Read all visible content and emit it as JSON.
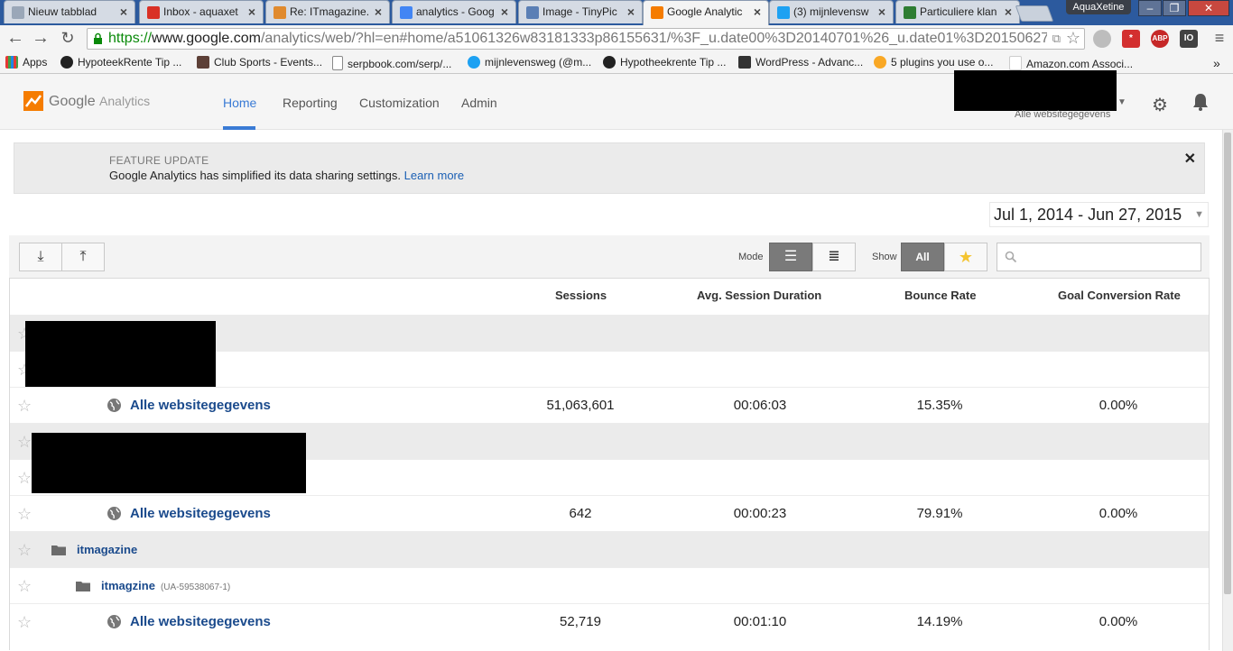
{
  "browser": {
    "tabs": [
      {
        "title": "Nieuw tabblad",
        "color": "#9aa7b8"
      },
      {
        "title": "Inbox - aquaxet",
        "color": "#d93025"
      },
      {
        "title": "Re: ITmagazine.",
        "color": "#e08a2e"
      },
      {
        "title": "analytics - Goog",
        "color": "#4285f4"
      },
      {
        "title": "Image - TinyPic",
        "color": "#5b7fb5"
      },
      {
        "title": "Google Analytic",
        "color": "#f57c00"
      },
      {
        "title": "(3) mijnlevensw",
        "color": "#1da1f2"
      },
      {
        "title": "Particuliere klan",
        "color": "#2e7d32"
      }
    ],
    "profile_name": "AquaXetine",
    "url": {
      "scheme": "https://",
      "host": "www.google.com",
      "path": "/analytics/web/?hl=en#home/a51061326w83181333p86155631/%3F_u.date00%3D20140701%26_u.date01%3D20150627/"
    },
    "extensions": [
      {
        "icon": "download-icon",
        "label": ""
      },
      {
        "icon": "lastpass-icon",
        "label": "*"
      },
      {
        "icon": "adblock-icon",
        "label": "ABP"
      },
      {
        "icon": "camera-icon",
        "label": "IO"
      }
    ],
    "bookmarks": [
      {
        "label": "Apps",
        "icon": "apps-icon"
      },
      {
        "label": "HypoteekRente Tip ...",
        "icon": "g-icon"
      },
      {
        "label": "Club Sports - Events...",
        "icon": "clubsports-icon"
      },
      {
        "label": "serpbook.com/serp/...",
        "icon": "page-icon"
      },
      {
        "label": "mijnlevensweg (@m...",
        "icon": "twitter-icon"
      },
      {
        "label": "Hypotheekrente Tip ...",
        "icon": "g-icon"
      },
      {
        "label": "WordPress - Advanc...",
        "icon": "wordpress-icon"
      },
      {
        "label": "5 plugins you use o...",
        "icon": "plugin-icon"
      },
      {
        "label": "Amazon.com Associ...",
        "icon": "amazon-icon"
      }
    ]
  },
  "ga": {
    "brand": {
      "google": "Google",
      "analytics": "Analytics"
    },
    "nav": [
      "Home",
      "Reporting",
      "Customization",
      "Admin"
    ],
    "account_label": "Alle websitegegevens",
    "banner": {
      "kicker": "FEATURE UPDATE",
      "message": "Google Analytics has simplified its data sharing settings.",
      "link": "Learn more"
    },
    "date_range": "Jul 1, 2014 - Jun 27, 2015",
    "controls": {
      "mode_label": "Mode",
      "show_label": "Show",
      "show_all": "All"
    },
    "columns": [
      "Sessions",
      "Avg. Session Duration",
      "Bounce Rate",
      "Goal Conversion Rate"
    ],
    "rows": [
      {
        "kind": "account",
        "name": "",
        "redacted": true
      },
      {
        "kind": "property",
        "name": "",
        "redacted": true
      },
      {
        "kind": "view",
        "name": "Alle websitegegevens",
        "sessions": "51,063,601",
        "duration": "00:06:03",
        "bounce": "15.35%",
        "goal": "0.00%"
      },
      {
        "kind": "account",
        "name": "",
        "redacted": true
      },
      {
        "kind": "property",
        "name": "",
        "redacted": true
      },
      {
        "kind": "view",
        "name": "Alle websitegegevens",
        "sessions": "642",
        "duration": "00:00:23",
        "bounce": "79.91%",
        "goal": "0.00%"
      },
      {
        "kind": "account",
        "name": "itmagazine"
      },
      {
        "kind": "property",
        "name": "itmagzine",
        "ua": "(UA-59538067-1)"
      },
      {
        "kind": "view",
        "name": "Alle websitegegevens",
        "sessions": "52,719",
        "duration": "00:01:10",
        "bounce": "14.19%",
        "goal": "0.00%"
      }
    ],
    "accent": "#3a7bd5",
    "link_color": "#1a4a8c"
  }
}
